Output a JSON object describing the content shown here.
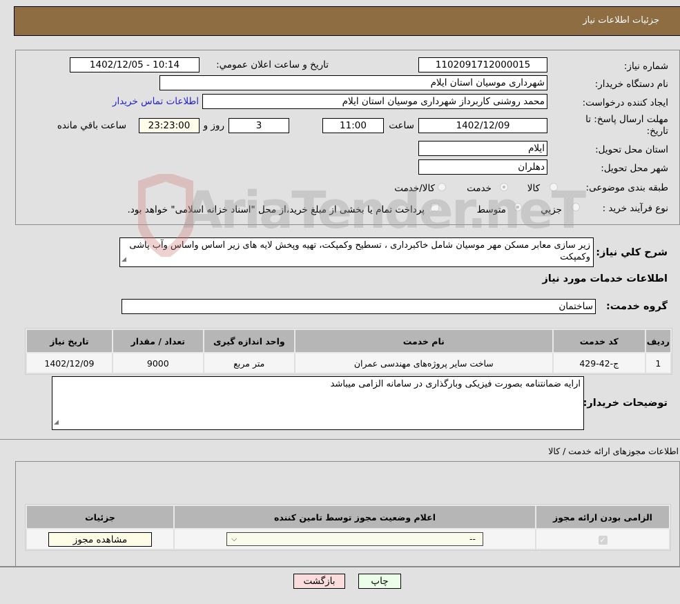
{
  "header": {
    "title": "جزئیات اطلاعات نیاز"
  },
  "form": {
    "need_number": {
      "label": "شماره نیاز:",
      "value": "1102091712000015"
    },
    "announce_datetime": {
      "label": "تاریخ و ساعت اعلان عمومي:",
      "value": "1402/12/05 - 10:14"
    },
    "buyer_org": {
      "label": "نام دستگاه خريدار:",
      "value": "شهرداری موسیان استان ایلام"
    },
    "requester": {
      "label": "ايجاد کننده درخواست:",
      "value": "محمد روشنی کاربرداز شهرداری موسیان استان ایلام"
    },
    "buyer_contact_link": "اطلاعات تماس خريدار",
    "deadline": {
      "label_line1": "مهلت ارسال پاسخ: تا",
      "label_line2": "تاريخ:",
      "date": "1402/12/09",
      "time_label": "ساعت",
      "time": "11:00",
      "days": "3",
      "days_label": "روز و",
      "remaining": "23:23:00",
      "remaining_label": "ساعت باقي مانده"
    },
    "province": {
      "label": "استان محل تحويل:",
      "value": "ایلام"
    },
    "city": {
      "label": "شهر محل تحويل:",
      "value": "دهلران"
    },
    "category": {
      "label": "طبقه بندی موضوعی:",
      "options": [
        "کالا",
        "خدمت",
        "کالا/خدمت"
      ],
      "selected": "خدمت"
    },
    "purchase_type": {
      "label": "نوع فرآيند خريد :",
      "options": [
        "جزيي",
        "متوسط"
      ],
      "selected": "متوسط",
      "treasury_note": "پرداخت تمام يا بخشی از مبلغ خريد،از محل \"اسناد خزانه اسلامی\" خواهد بود."
    }
  },
  "description": {
    "label": "شرح كلي نياز:",
    "value": "زیر سازی معابر مسکن مهر موسیان شامل خاکبرداری ، تسطیح وکمپکت، تهیه وپخش لایه های زیر اساس واساس وآب پاشی وکمپکت"
  },
  "services_section_title": "اطلاعات خدمات مورد نياز",
  "service_group": {
    "label": "گروه خدمت:",
    "value": "ساختمان"
  },
  "services_table": {
    "headers": [
      "رديف",
      "کد خدمت",
      "نام خدمت",
      "واحد اندازه گيری",
      "تعداد / مقدار",
      "تاريخ نياز"
    ],
    "rows": [
      [
        "1",
        "ج-42-429",
        "ساخت سایر پروژه‌های مهندسی عمران",
        "متر مربع",
        "9000",
        "1402/12/09"
      ]
    ]
  },
  "buyer_notes": {
    "label": "توضيحات خريدار:",
    "value": "ارایه ضمانتنامه بصورت فیزیکی وبارگذاری در سامانه الزامی میباشد"
  },
  "permits_section_title": "اطلاعات مجوزهای ارائه خدمت / کالا",
  "permits_table": {
    "headers": [
      "الزامی بودن ارائه مجوز",
      "اعلام وضعيت مجوز توسط تامين کننده",
      "جزئيات"
    ],
    "rows": [
      {
        "required_checked": true,
        "status_selected": "--",
        "details_button": "مشاهده مجوز"
      }
    ]
  },
  "buttons": {
    "print": "چاپ",
    "back": "بازگشت"
  },
  "watermark": {
    "text": "AriaTender.neT"
  }
}
